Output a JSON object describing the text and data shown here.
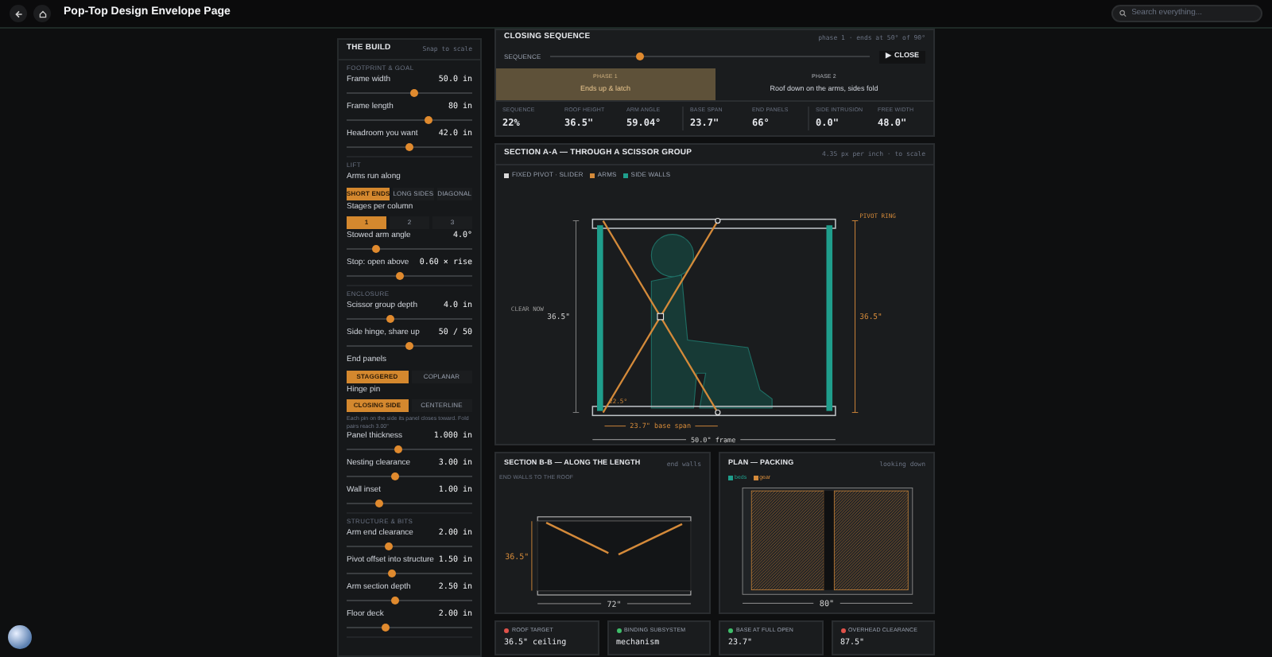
{
  "topbar": {
    "title": "Pop-Top Design Envelope Page",
    "search": {
      "placeholder": "Search everything..."
    }
  },
  "sidebar": {
    "title": "THE BUILD",
    "link": "Snap to scale",
    "groups": [
      {
        "heading": "FOOTPRINT & GOAL",
        "controls": [
          {
            "kind": "slider",
            "label": "Frame width",
            "value": "50.0 in",
            "level": 0.54
          },
          {
            "kind": "slider",
            "label": "Frame length",
            "value": "80 in",
            "level": 0.65
          },
          {
            "kind": "slider",
            "label": "Headroom you want",
            "value": "42.0 in",
            "level": 0.5
          }
        ]
      },
      {
        "heading": "LIFT",
        "controls": [
          {
            "kind": "segmented",
            "label": "Arms run along",
            "options": [
              {
                "label": "SHORT ENDS",
                "selected": true
              },
              {
                "label": "LONG SIDES",
                "selected": false
              },
              {
                "label": "DIAGONAL",
                "selected": false
              }
            ]
          },
          {
            "kind": "segmented",
            "label": "Stages per column",
            "options": [
              {
                "label": "1",
                "selected": true
              },
              {
                "label": "2",
                "selected": false
              },
              {
                "label": "3",
                "selected": false
              }
            ]
          },
          {
            "kind": "slider",
            "label": "Stowed arm angle",
            "value": "4.0°",
            "level": 0.23
          },
          {
            "kind": "slider",
            "label": "Stop: open above",
            "value": "0.60 × rise",
            "level": 0.43
          }
        ]
      },
      {
        "heading": "ENCLOSURE",
        "controls": [
          {
            "kind": "slider",
            "label": "Scissor group depth",
            "value": "4.0 in",
            "level": 0.35
          },
          {
            "kind": "slider",
            "label": "Side hinge, share up",
            "value": "50 / 50",
            "level": 0.5
          },
          {
            "kind": "segmented",
            "label": "End panels",
            "options": [
              {
                "label": "STAGGERED",
                "selected": true
              },
              {
                "label": "COPLANAR",
                "selected": false
              }
            ]
          },
          {
            "kind": "segmented",
            "label": "Hinge pin",
            "options": [
              {
                "label": "CLOSING SIDE",
                "selected": true
              },
              {
                "label": "CENTERLINE",
                "selected": false
              }
            ],
            "note": "Each pin on the side its panel closes toward. Fold pairs reach 3.00\""
          },
          {
            "kind": "slider",
            "label": "Panel thickness",
            "value": "1.000 in",
            "level": 0.41
          },
          {
            "kind": "slider",
            "label": "Nesting clearance",
            "value": "3.00 in",
            "level": 0.38
          },
          {
            "kind": "slider",
            "label": "Wall inset",
            "value": "1.00 in",
            "level": 0.26
          }
        ]
      },
      {
        "heading": "STRUCTURE & BITS",
        "controls": [
          {
            "kind": "slider",
            "label": "Arm end clearance",
            "value": "2.00 in",
            "level": 0.33
          },
          {
            "kind": "slider",
            "label": "Pivot offset into structure",
            "value": "1.50 in",
            "level": 0.36
          },
          {
            "kind": "slider",
            "label": "Arm section depth",
            "value": "2.50 in",
            "level": 0.38
          },
          {
            "kind": "slider",
            "label": "Floor deck",
            "value": "2.00 in",
            "level": 0.31
          }
        ]
      }
    ]
  },
  "sequence": {
    "title": "CLOSING SEQUENCE",
    "note": "phase 1 · ends at 50° of 90°",
    "slider_label": "SEQUENCE",
    "level": 0.28,
    "button": "▶ CLOSE",
    "phases": [
      {
        "label": "PHASE 1",
        "caption": "Ends up & latch",
        "selected": true
      },
      {
        "label": "PHASE 2",
        "caption": "Roof down on the arms, sides fold",
        "selected": false
      }
    ],
    "stat_groups": [
      {
        "stats": [
          {
            "label": "SEQUENCE",
            "value": "22%"
          },
          {
            "label": "ROOF HEIGHT",
            "value": "36.5\""
          },
          {
            "label": "ARM ANGLE",
            "value": "59.04°"
          }
        ]
      },
      {
        "stats": [
          {
            "label": "BASE SPAN",
            "value": "23.7\""
          },
          {
            "label": "END PANELS",
            "value": "66°"
          }
        ]
      },
      {
        "stats": [
          {
            "label": "SIDE INTRUSION",
            "value": "0.0\""
          },
          {
            "label": "FREE WIDTH",
            "value": "48.0\""
          }
        ]
      }
    ]
  },
  "section_a": {
    "title": "SECTION A-A — THROUGH A SCISSOR GROUP",
    "note": "4.35 px per inch · to scale",
    "legend": [
      {
        "label": "FIXED PIVOT · SLIDER",
        "color": "#d9d9d9"
      },
      {
        "label": "ARMS",
        "color": "#d48a3a"
      },
      {
        "label": "SIDE WALLS",
        "color": "#1f9e8c"
      }
    ],
    "pivot_ring": "PIVOT RING",
    "clear_now": "CLEAR NOW",
    "height_left": "36.5\"",
    "height_right": "36.5\"",
    "angle": "22.5°",
    "base_span": "23.7\" base span",
    "frame": "50.0\" frame"
  },
  "section_b": {
    "title": "SECTION B-B — ALONG THE LENGTH",
    "note": "end walls",
    "subtitle": "END WALLS TO THE ROOF",
    "height": "36.5\"",
    "length": "72\""
  },
  "plan": {
    "title": "PLAN — PACKING",
    "note": "looking down",
    "legend": [
      {
        "label": "beds",
        "color": "#1f9e8c"
      },
      {
        "label": "gear",
        "color": "#d48a3a"
      }
    ],
    "width": "80\""
  },
  "status": [
    {
      "label": "ROOF TARGET",
      "value": "36.5\" ceiling",
      "color": "#e0524a"
    },
    {
      "label": "BINDING SUBSYSTEM",
      "value": "mechanism",
      "color": "#3fbf6a"
    },
    {
      "label": "BASE AT FULL OPEN",
      "value": "23.7\"",
      "color": "#3fbf6a"
    },
    {
      "label": "OVERHEAD CLEARANCE",
      "value": "87.5\"",
      "color": "#e0524a"
    }
  ]
}
